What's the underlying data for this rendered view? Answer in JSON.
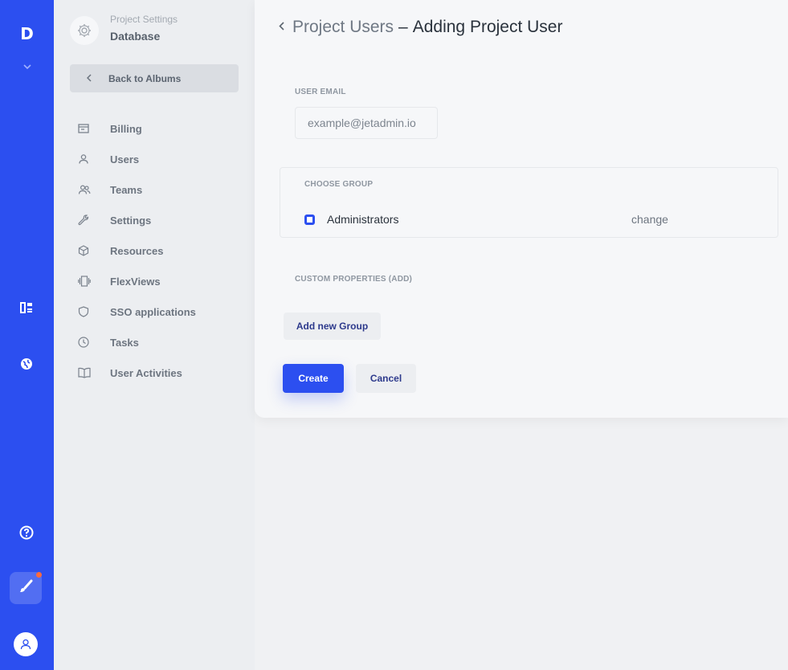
{
  "rail": {
    "logo_letter": "D",
    "icons": [
      "chevron-down-icon",
      "dashboard-icon",
      "globe-icon",
      "help-icon",
      "brush-icon",
      "user-avatar-icon"
    ],
    "accent": "#2c4ff0",
    "notif_color": "#ff6a3d"
  },
  "sidebar": {
    "section_label": "Project Settings",
    "section_title": "Database",
    "back_label": "Back to Albums",
    "items": [
      {
        "label": "Billing",
        "icon": "billing-icon"
      },
      {
        "label": "Users",
        "icon": "user-icon"
      },
      {
        "label": "Teams",
        "icon": "teams-icon"
      },
      {
        "label": "Settings",
        "icon": "wrench-icon"
      },
      {
        "label": "Resources",
        "icon": "cube-icon"
      },
      {
        "label": "FlexViews",
        "icon": "flexviews-icon"
      },
      {
        "label": "SSO applications",
        "icon": "shield-icon"
      },
      {
        "label": "Tasks",
        "icon": "clock-icon"
      },
      {
        "label": "User Activities",
        "icon": "book-icon"
      }
    ]
  },
  "main": {
    "breadcrumb_link": "Project Users",
    "breadcrumb_sep": "–",
    "title": "Adding Project User",
    "email": {
      "label": "USER EMAIL",
      "placeholder": "example@jetadmin.io"
    },
    "group": {
      "label": "CHOOSE GROUP",
      "selected": "Administrators",
      "change_label": "change"
    },
    "custom_properties_label": "CUSTOM PROPERTIES (ADD)",
    "add_group_label": "Add new Group",
    "create_label": "Create",
    "cancel_label": "Cancel"
  }
}
